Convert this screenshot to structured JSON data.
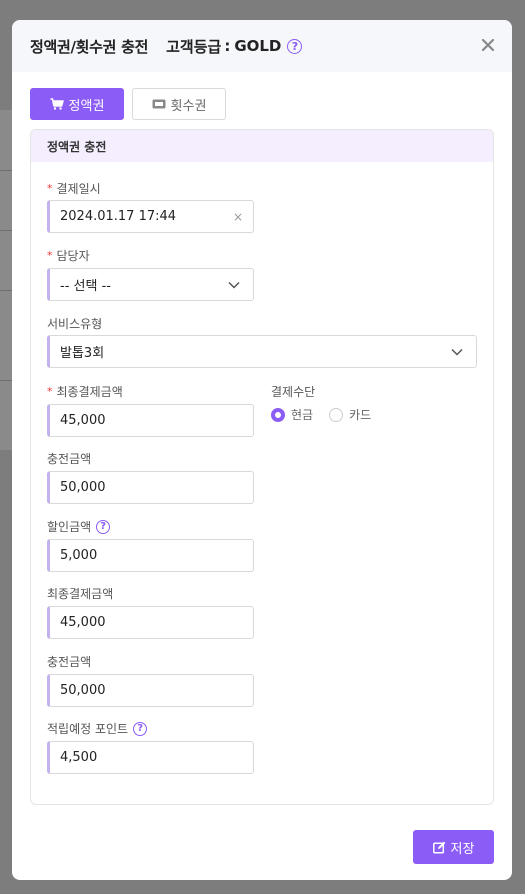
{
  "modal": {
    "title": "정액권/횟수권 충전",
    "grade_label": "고객등급",
    "grade_colon": ":",
    "grade_value": "GOLD",
    "help_glyph": "?",
    "close_glyph": "✕"
  },
  "tabs": [
    {
      "label": "정액권",
      "icon": "cart-icon",
      "active": true
    },
    {
      "label": "횟수권",
      "icon": "ticket-icon",
      "active": false
    }
  ],
  "panel": {
    "title": "정액권 충전"
  },
  "fields": {
    "payment_datetime": {
      "label": "결제일시",
      "required": true,
      "value": "2024.01.17  17:44",
      "clear_glyph": "×"
    },
    "manager": {
      "label": "담당자",
      "required": true,
      "value": "-- 선택 --"
    },
    "service_type": {
      "label": "서비스유형",
      "required": false,
      "value": "발톱3회"
    },
    "final_amount": {
      "label": "최종결제금액",
      "required": true,
      "value": "45,000"
    },
    "payment_method": {
      "label": "결제수단",
      "options": [
        "현금",
        "카드"
      ],
      "selected": "현금"
    },
    "charge_amount": {
      "label": "충전금액",
      "value": "50,000"
    },
    "discount_amount": {
      "label": "할인금액",
      "value": "5,000"
    },
    "final_amount_2": {
      "label": "최종결제금액",
      "value": "45,000"
    },
    "charge_amount_2": {
      "label": "충전금액",
      "value": "50,000"
    },
    "reward_points": {
      "label": "적립예정 포인트",
      "value": "4,500"
    }
  },
  "required_mark": "*",
  "save_label": "저장",
  "colors": {
    "accent": "#8b5cf6",
    "panel_header_bg": "#f4eefe",
    "input_left_border": "#c4b2f0",
    "required": "#e53935"
  }
}
